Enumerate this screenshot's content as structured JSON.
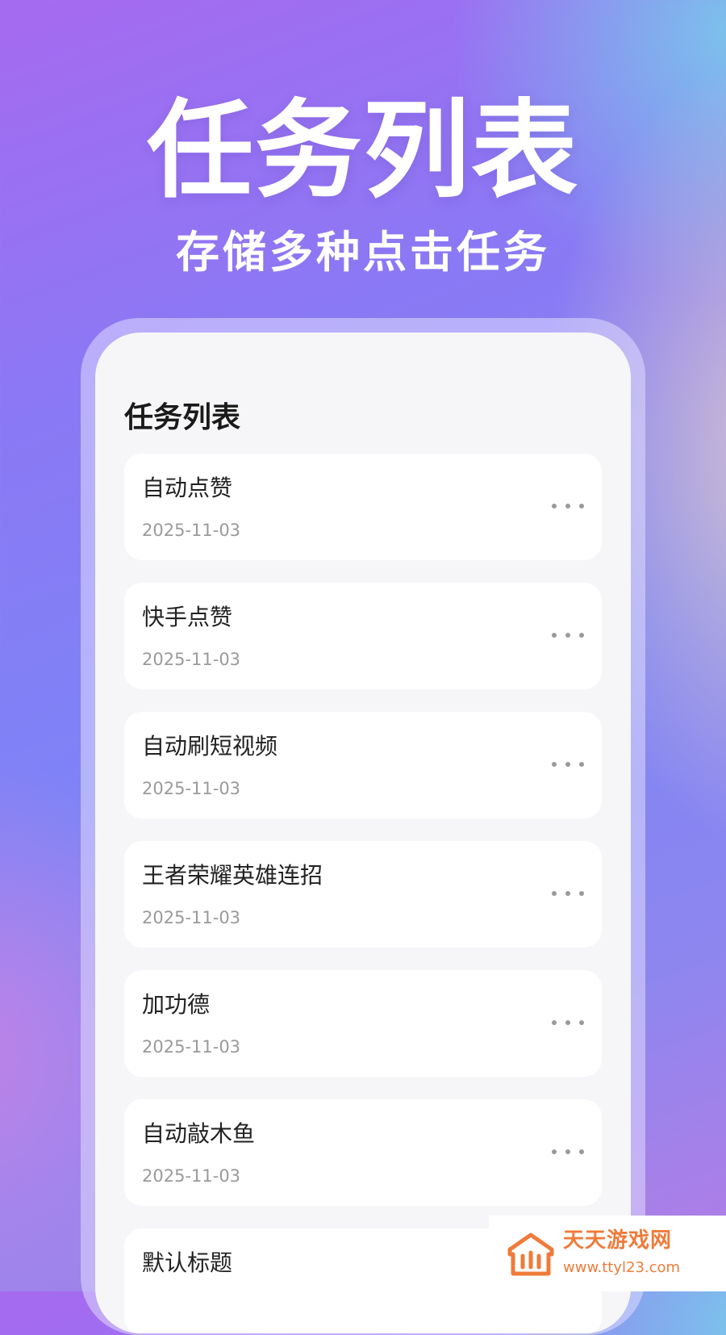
{
  "hero": {
    "title": "任务列表",
    "subtitle": "存储多种点击任务"
  },
  "screen": {
    "title": "任务列表",
    "tasks": [
      {
        "name": "自动点赞",
        "date": "2025-11-03"
      },
      {
        "name": "快手点赞",
        "date": "2025-11-03"
      },
      {
        "name": "自动刷短视频",
        "date": "2025-11-03"
      },
      {
        "name": "王者荣耀英雄连招",
        "date": "2025-11-03"
      },
      {
        "name": "加功德",
        "date": "2025-11-03"
      },
      {
        "name": "自动敲木鱼",
        "date": "2025-11-03"
      },
      {
        "name": "默认标题",
        "date": ""
      }
    ],
    "item_menu_icon": "more-horizontal-icon"
  },
  "watermark": {
    "name": "天天游戏网",
    "url": "www.ttyl23.com"
  },
  "colors": {
    "hero_text": "#ffffff",
    "card_background": "#ffffff",
    "screen_background": "#f6f6f8",
    "title_text": "#1a1a1a",
    "date_text": "#9a9a9a",
    "watermark_accent": "#ef7b3a"
  }
}
